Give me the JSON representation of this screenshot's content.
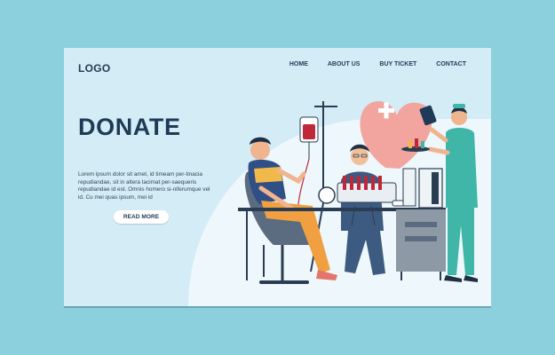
{
  "header": {
    "logo": "LOGO",
    "nav": [
      "HOME",
      "ABOUT US",
      "BUY TICKET",
      "CONTACT"
    ]
  },
  "hero": {
    "title": "DONATE",
    "body": "Lorem ipsum dolor sit amet, id timeam per-tinacia repudiandae, sit in altera tacimat per-saequeris repudiandae id est. Omnis homero si-niferumque vel id. Cu mei quas ipsum, mei id",
    "cta_label": "READ MORE"
  },
  "colors": {
    "page_background": "#8ccfdd",
    "card_background": "#d4ecf5",
    "heading": "#1f3a56",
    "heart": "#f2a59f",
    "blood": "#c0283a",
    "scrubs": "#3fb6a8"
  }
}
